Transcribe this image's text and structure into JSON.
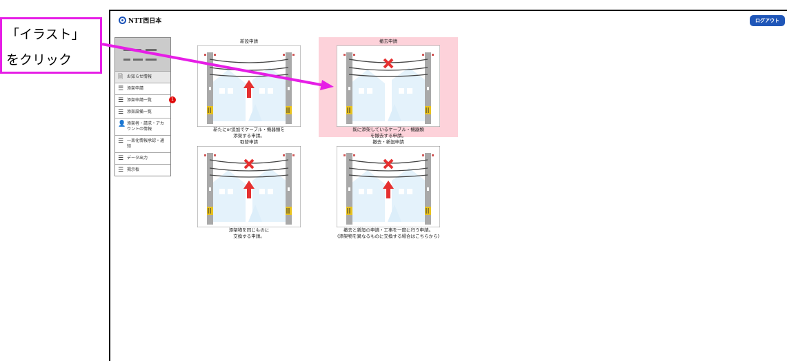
{
  "annotation": {
    "line1": "「イラスト」",
    "line2": "をクリック",
    "color": "#e61ee6"
  },
  "header": {
    "logo": "NTT西日本",
    "logout": "ログアウト"
  },
  "sidebar": {
    "items": [
      {
        "label": "お知らせ情報",
        "icon": "document-icon"
      },
      {
        "label": "添架申請",
        "icon": "list-icon"
      },
      {
        "label": "添架申請一覧",
        "icon": "list-icon",
        "badge": "1"
      },
      {
        "label": "添架設備一覧",
        "icon": "list-icon"
      },
      {
        "label": "添架者・請求・アカウントの情報",
        "icon": "user-icon"
      },
      {
        "label": "一束化情報承認・通知",
        "icon": "list-icon"
      },
      {
        "label": "データ出力",
        "icon": "list-icon"
      },
      {
        "label": "掲示板",
        "icon": "list-icon"
      }
    ]
  },
  "cards": [
    {
      "title": "新設申請",
      "desc1": "新たにor追加でケーブル・機器類を",
      "desc2": "添架する申請。"
    },
    {
      "title": "撤去申請",
      "desc1": "既に添架しているケーブル・機器類",
      "desc2": "を撤去する申請。"
    },
    {
      "title": "取替申請",
      "desc1": "添架物を同じものに",
      "desc2": "交換する申請。"
    },
    {
      "title": "撤去・新設申請",
      "desc1": "撤去と新設の申請・工事を一度に行う申請。",
      "desc2": "(添架物を異なるものに交換する場合はこちらから)"
    }
  ]
}
